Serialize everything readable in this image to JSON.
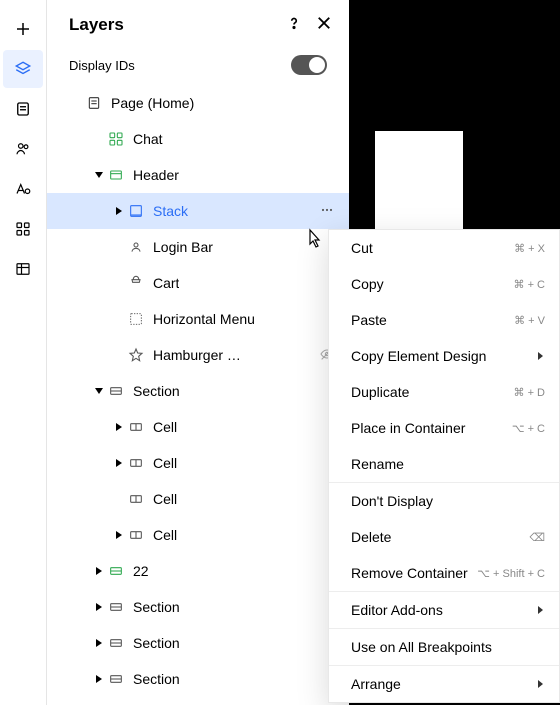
{
  "panel": {
    "title": "Layers",
    "display_ids_label": "Display IDs"
  },
  "tree": {
    "page": {
      "label": "Page (Home)"
    },
    "chat": {
      "label": "Chat"
    },
    "header": {
      "label": "Header"
    },
    "stack": {
      "label": "Stack"
    },
    "login_bar": {
      "label": "Login Bar"
    },
    "cart": {
      "label": "Cart"
    },
    "horizontal_menu": {
      "label": "Horizontal Menu"
    },
    "hamburger": {
      "label": "Hamburger …"
    },
    "section1": {
      "label": "Section"
    },
    "cell1": {
      "label": "Cell"
    },
    "cell2": {
      "label": "Cell"
    },
    "cell3": {
      "label": "Cell"
    },
    "cell4": {
      "label": "Cell"
    },
    "twentytwo": {
      "label": "22"
    },
    "section2": {
      "label": "Section"
    },
    "section3": {
      "label": "Section"
    },
    "section4": {
      "label": "Section"
    }
  },
  "context": {
    "cut": {
      "label": "Cut",
      "shortcut": "⌘ + X"
    },
    "copy": {
      "label": "Copy",
      "shortcut": "⌘ + C"
    },
    "paste": {
      "label": "Paste",
      "shortcut": "⌘ + V"
    },
    "copy_design": {
      "label": "Copy Element Design"
    },
    "duplicate": {
      "label": "Duplicate",
      "shortcut": "⌘ + D"
    },
    "place_in_container": {
      "label": "Place in Container",
      "shortcut": "⌥ + C"
    },
    "rename": {
      "label": "Rename"
    },
    "dont_display": {
      "label": "Don't Display"
    },
    "delete": {
      "label": "Delete",
      "shortcut": "⌫"
    },
    "remove_container": {
      "label": "Remove Container",
      "shortcut": "⌥ + Shift + C"
    },
    "editor_addons": {
      "label": "Editor Add-ons"
    },
    "use_all_breakpoints": {
      "label": "Use on All Breakpoints"
    },
    "arrange": {
      "label": "Arrange"
    }
  }
}
